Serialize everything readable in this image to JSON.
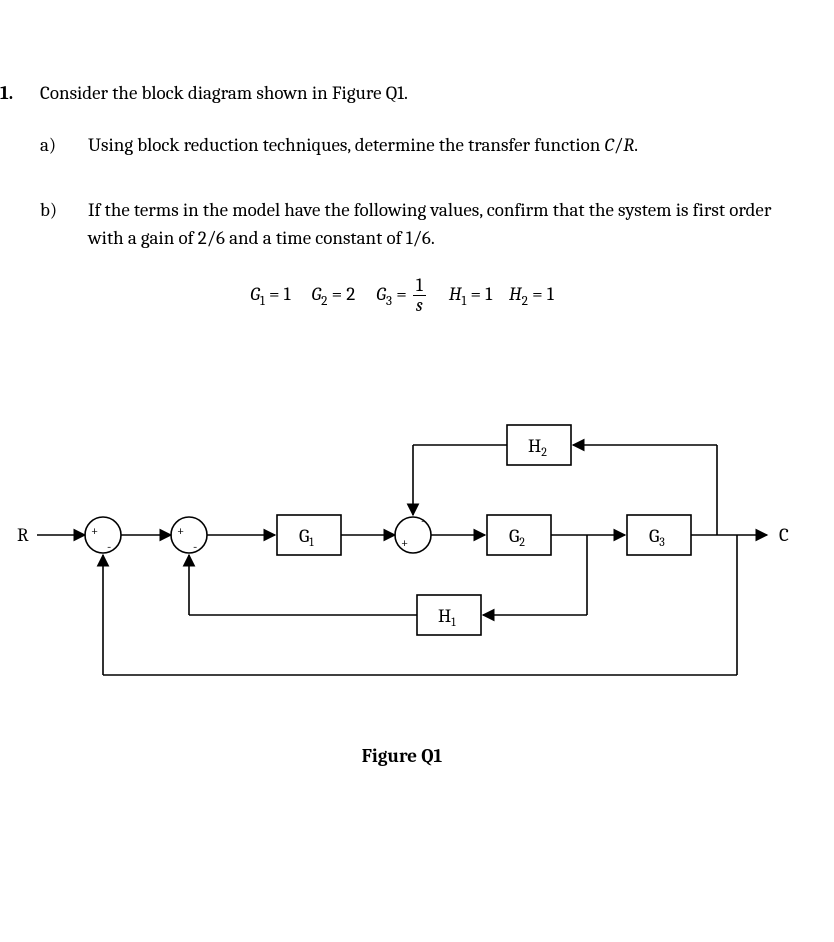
{
  "question": {
    "number": "1.",
    "stem": "Consider the block diagram shown in Figure Q1.",
    "parts": {
      "a": {
        "label": "a)",
        "text": "Using block reduction techniques, determine the transfer function  C/R."
      },
      "b": {
        "label": "b)",
        "text": "If the terms in the model have the following values, confirm that the system is first order with a gain of 2/6 and a time constant of 1/6."
      }
    },
    "equations": {
      "G1": "G₁ = 1",
      "G2": "G₂ = 2",
      "G3_lhs": "G₃ =",
      "G3_num": "1",
      "G3_den": "s",
      "H1": "H₁ = 1",
      "H2": "H₂ = 1"
    }
  },
  "diagram": {
    "input_label": "R",
    "output_label": "C",
    "blocks": {
      "G1": "G₁",
      "G2": "G₂",
      "G3": "G₃",
      "H1": "H₁",
      "H2": "H₂"
    },
    "sum1": {
      "in_plus": "+",
      "fb_minus": "-"
    },
    "sum2": {
      "in_plus": "+",
      "fb_minus": "-"
    },
    "sum3": {
      "in_plus": "+",
      "fb_minus": "-"
    },
    "caption": "Figure Q1"
  },
  "chart_data": {
    "type": "block-diagram",
    "nodes": [
      {
        "id": "R",
        "kind": "port",
        "label": "R"
      },
      {
        "id": "S1",
        "kind": "sum",
        "inputs": [
          {
            "from": "R",
            "sign": "+"
          },
          {
            "from": "fb_outer",
            "sign": "-"
          }
        ]
      },
      {
        "id": "S2",
        "kind": "sum",
        "inputs": [
          {
            "from": "S1",
            "sign": "+"
          },
          {
            "from": "H1_out",
            "sign": "-"
          }
        ]
      },
      {
        "id": "G1",
        "kind": "block",
        "label": "G1"
      },
      {
        "id": "S3",
        "kind": "sum",
        "inputs": [
          {
            "from": "G1",
            "sign": "+"
          },
          {
            "from": "H2_out",
            "sign": "-"
          }
        ]
      },
      {
        "id": "G2",
        "kind": "block",
        "label": "G2"
      },
      {
        "id": "G3",
        "kind": "block",
        "label": "G3"
      },
      {
        "id": "C",
        "kind": "port",
        "label": "C"
      },
      {
        "id": "H1",
        "kind": "block",
        "label": "H1"
      },
      {
        "id": "H2",
        "kind": "block",
        "label": "H2"
      }
    ],
    "edges": [
      {
        "from": "R",
        "to": "S1"
      },
      {
        "from": "S1",
        "to": "S2"
      },
      {
        "from": "S2",
        "to": "G1"
      },
      {
        "from": "G1",
        "to": "S3"
      },
      {
        "from": "S3",
        "to": "G2"
      },
      {
        "from": "G2",
        "to": "G3"
      },
      {
        "from": "G3",
        "to": "C"
      },
      {
        "from": "G2_out_tap",
        "to": "H1",
        "note": "pickoff after G2"
      },
      {
        "from": "H1",
        "to": "S2",
        "sign": "-"
      },
      {
        "from": "C_tap",
        "to": "H2",
        "note": "pickoff after G3"
      },
      {
        "from": "H2",
        "to": "S3",
        "sign": "-"
      },
      {
        "from": "C_tap",
        "to": "S1",
        "sign": "-",
        "note": "outer unity feedback"
      }
    ],
    "parameters": {
      "G1": 1,
      "G2": 2,
      "G3": "1/s",
      "H1": 1,
      "H2": 1
    },
    "claimed_result": {
      "order": 1,
      "gain": "2/6",
      "time_constant": "1/6"
    }
  }
}
